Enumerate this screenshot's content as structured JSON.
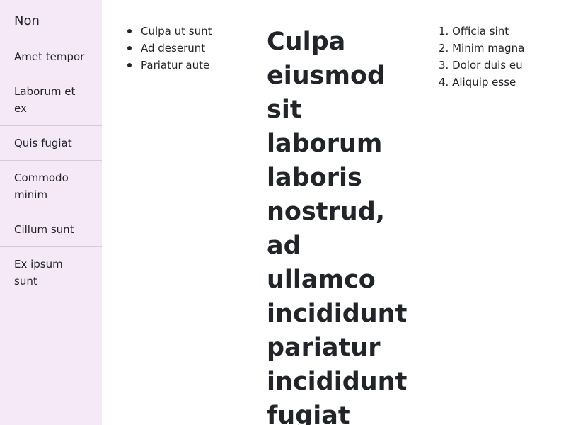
{
  "sidebar": {
    "brand": "Non",
    "items": [
      {
        "label": "Amet tempor"
      },
      {
        "label": "Laborum et ex"
      },
      {
        "label": "Quis fugiat"
      },
      {
        "label": "Commodo minim"
      },
      {
        "label": "Cillum sunt"
      },
      {
        "label": "Ex ipsum sunt"
      }
    ]
  },
  "bullet_list": [
    "Culpa ut sunt",
    "Ad deserunt",
    "Pariatur aute"
  ],
  "heading": "Culpa eiusmod sit laborum laboris nostrud, ad ullamco incididunt pariatur incididunt fugiat",
  "ordered_list": [
    "1. Officia sint",
    "2. Minim magna",
    "3. Dolor duis eu",
    "4. Aliquip esse"
  ]
}
